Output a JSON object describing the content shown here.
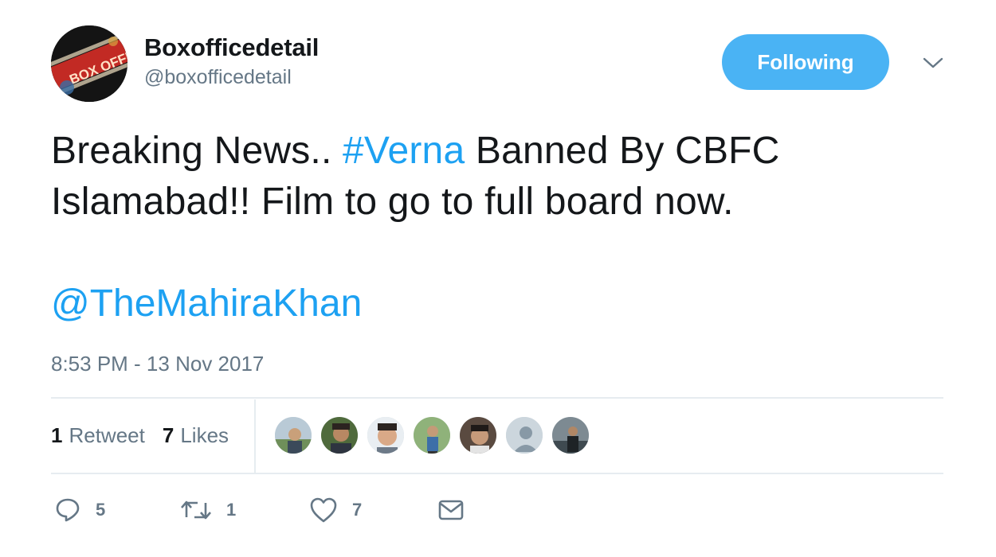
{
  "user": {
    "display_name": "Boxofficedetail",
    "handle": "@boxofficedetail",
    "avatar_icon": "box-office-avatar",
    "avatar_text": "BOX OFFI"
  },
  "follow_button": {
    "label": "Following"
  },
  "tweet": {
    "text_before": "Breaking News.. ",
    "hashtag": "#Verna",
    "text_after": " Banned By CBFC Islamabad!! Film to go to full board now.",
    "mention": "@TheMahiraKhan",
    "timestamp": "8:53 PM - 13 Nov 2017"
  },
  "stats": {
    "retweets_count": "1",
    "retweets_label": "Retweet",
    "likes_count": "7",
    "likes_label": "Likes"
  },
  "likers": [
    "avatar-1",
    "avatar-2",
    "avatar-3",
    "avatar-4",
    "avatar-5",
    "avatar-6",
    "avatar-7"
  ],
  "actions": {
    "reply_count": "5",
    "retweet_count": "1",
    "like_count": "7"
  },
  "colors": {
    "accent": "#1da1f2",
    "button": "#4ab3f4",
    "muted": "#657786"
  }
}
